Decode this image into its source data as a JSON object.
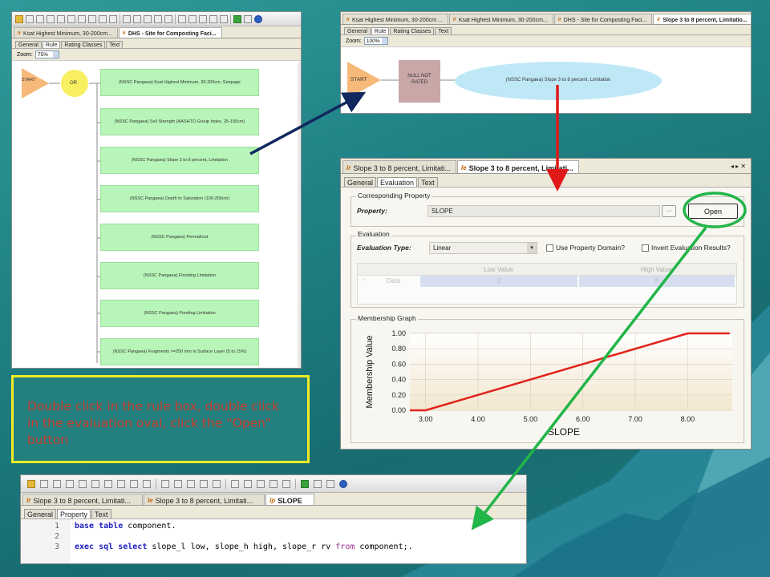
{
  "rule_editor": {
    "doc_tabs": [
      "Ksat Highest Minimum, 30-200cm...",
      "DHS - Site for Composting Faci..."
    ],
    "section_tabs": [
      "General",
      "Rule",
      "Rating Classes",
      "Text"
    ],
    "zoom_label": "Zoom:",
    "zoom_value": "75%",
    "start_label": "START",
    "or_label": "OR",
    "rules": [
      "(NSSC Pangaea) Ksat Highest Minimum, 30-200cm, Seepage",
      "(NSSC Pangaea) Soil Strength (AASHTO Group Index, 25-100cm)",
      "(NSSC Pangaea) Slope 3 to 8 percent, Limitation",
      "(NSSC Pangaea) Depth to Saturation (100-200cm)",
      "(NSSC Pangaea) Permafrost",
      "(NSSC Pangaea) Flooding Limitation",
      "(NSSC Pangaea) Ponding Limitation",
      "(NSSC Pangaea) Fragments >=250 mm in Surface Layer (5 to 15%)"
    ]
  },
  "subrule_editor": {
    "doc_tabs": [
      "Ksat Highest Minimum, 30-200cm ...",
      "Ksat Highest Minimum, 30-200cm...",
      "DHS - Site for Composting Faci...",
      "Slope 3 to 8 percent, Limitatio..."
    ],
    "section_tabs": [
      "General",
      "Rule",
      "Rating Classes",
      "Text"
    ],
    "zoom_label": "Zoom:",
    "zoom_value": "100%",
    "start_label": "START",
    "null_label": "NULL NOT RATED",
    "evaluation_label": "(NSSC Pangaea) Slope 3 to 8 percent, Limitation"
  },
  "evaluation_editor": {
    "doc_tabs": [
      "Slope 3 to 8 percent, Limitati...",
      "Slope 3 to 8 percent, Limitati..."
    ],
    "section_tabs": [
      "General",
      "Evaluation",
      "Text"
    ],
    "corresponding_property_title": "Corresponding Property",
    "property_label": "Property:",
    "property_value": "SLOPE",
    "ellipsis": "···",
    "open_button": "Open",
    "evaluation_title": "Evaluation",
    "evaluation_type_label": "Evaluation Type:",
    "evaluation_type_value": "Linear",
    "use_property_domain": "Use Property Domain?",
    "invert_results": "Invert Evaluation Results?",
    "grid_headers": [
      "Low Value",
      "High Value"
    ],
    "grid_row_label": "Data",
    "grid_row_values": [
      "3",
      "8"
    ],
    "membership_graph_title": "Membership Graph"
  },
  "chart_data": {
    "type": "line",
    "xlabel": "SLOPE",
    "ylabel": "Membership Value",
    "xlim": [
      2.7,
      8.85
    ],
    "ylim": [
      0,
      1.0
    ],
    "x_ticks": [
      "3.00",
      "4.00",
      "5.00",
      "6.00",
      "7.00",
      "8.00"
    ],
    "y_ticks": [
      "0.00",
      "0.20",
      "0.40",
      "0.60",
      "0.80",
      "1.00"
    ],
    "grid": true,
    "x": [
      2.7,
      3.0,
      8.0,
      8.8
    ],
    "y": [
      0.0,
      0.0,
      1.0,
      1.0
    ],
    "line_color": "#e0241b"
  },
  "property_editor": {
    "doc_tabs": [
      "Slope 3 to 8 percent, Limitati...",
      "Slope 3 to 8 percent, Limitati...",
      "SLOPE"
    ],
    "section_tabs": [
      "General",
      "Property",
      "Text"
    ],
    "code_lines": [
      {
        "n": "1",
        "text": "base table component."
      },
      {
        "n": "2",
        "text": ""
      },
      {
        "n": "3",
        "text": "exec sql select slope_l low, slope_h high, slope_r rv from component;."
      }
    ]
  },
  "instruction_note": "Double click in the rule box, double click in the evaluation oval, click the “Open” button",
  "colors": {
    "background": "#1f7f82",
    "note_border": "#f1ec24",
    "note_text": "#c43a2a",
    "arrow_navy": "#10285e",
    "arrow_red": "#e01818",
    "arrow_green": "#22b548",
    "rule_box": "#b8f5b8",
    "start_triangle": "#f7b97a",
    "or_circle": "#f8f060",
    "evaluation_oval": "#bfe8f7",
    "null_box": "#c9a7a7"
  }
}
